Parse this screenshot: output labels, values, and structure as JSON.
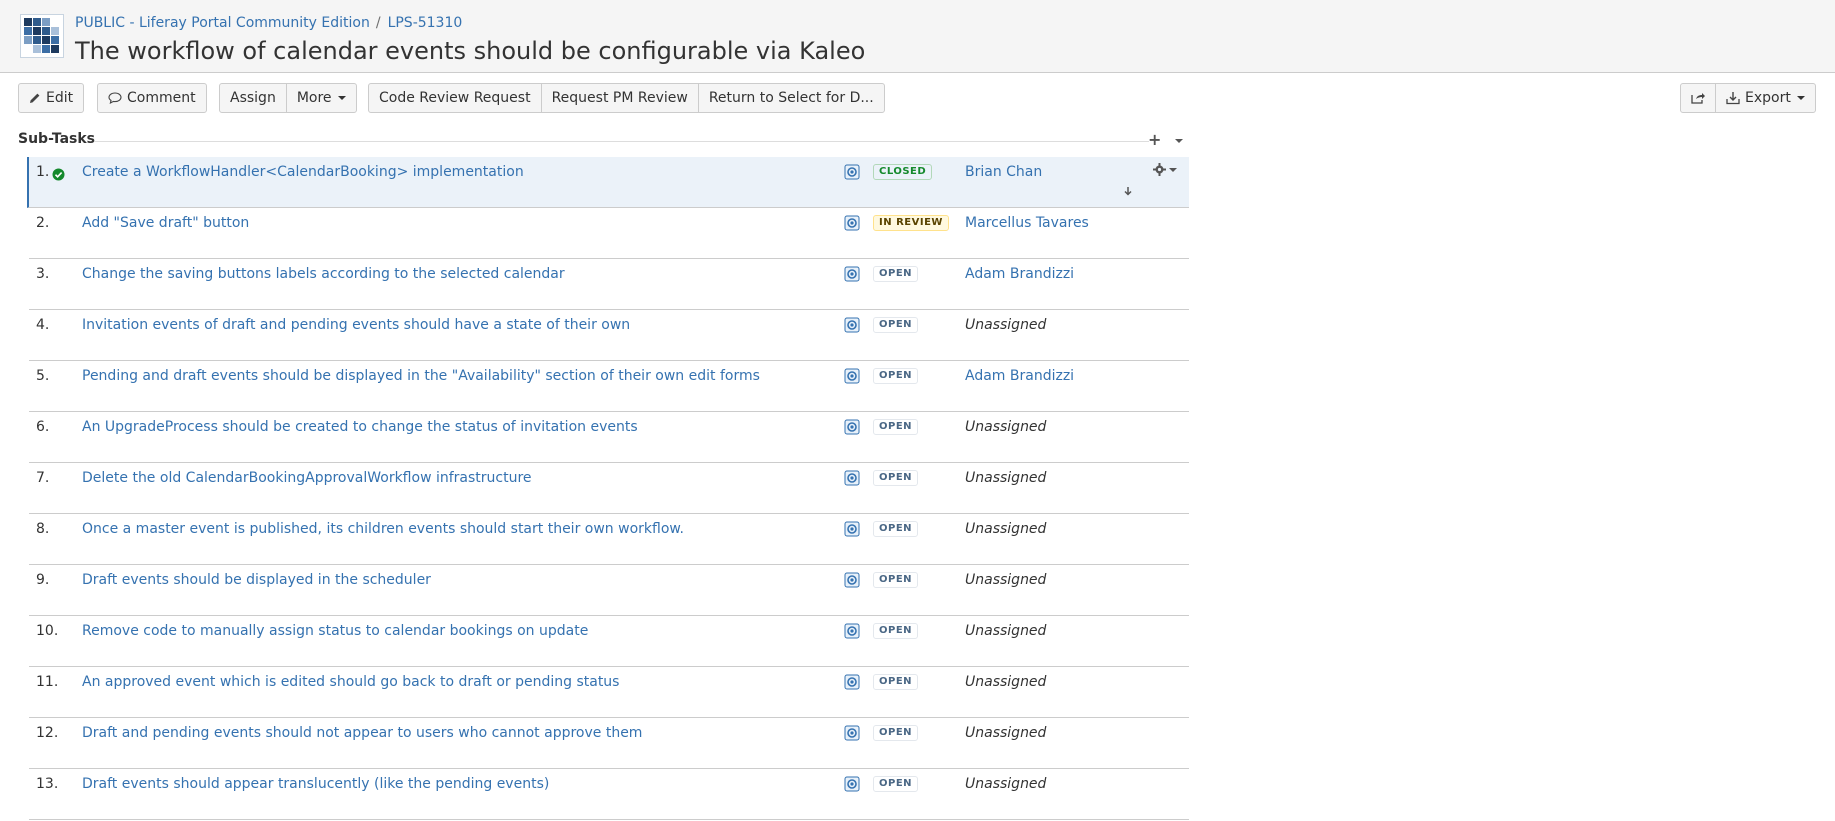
{
  "header": {
    "project": "PUBLIC - Liferay Portal Community Edition",
    "separator": "/",
    "issue_key": "LPS-51310",
    "title": "The workflow of calendar events should be configurable via Kaleo"
  },
  "toolbar": {
    "edit": "Edit",
    "comment": "Comment",
    "assign": "Assign",
    "more": "More",
    "code_review": "Code Review Request",
    "pm_review": "Request PM Review",
    "return_select": "Return to Select for D...",
    "export": "Export"
  },
  "subtasks": {
    "label": "Sub-Tasks",
    "rows": [
      {
        "num": "1.",
        "summary": "Create a WorkflowHandler<CalendarBooking> implementation",
        "status": "CLOSED",
        "assignee": "Brian Chan"
      },
      {
        "num": "2.",
        "summary": "Add \"Save draft\" button",
        "status": "IN REVIEW",
        "assignee": "Marcellus Tavares"
      },
      {
        "num": "3.",
        "summary": "Change the saving buttons labels according to the selected calendar",
        "status": "OPEN",
        "assignee": "Adam Brandizzi"
      },
      {
        "num": "4.",
        "summary": "Invitation events of draft and pending events should have a state of their own",
        "status": "OPEN",
        "assignee": "Unassigned"
      },
      {
        "num": "5.",
        "summary": "Pending and draft events should be displayed in the \"Availability\" section of their own edit forms",
        "status": "OPEN",
        "assignee": "Adam Brandizzi"
      },
      {
        "num": "6.",
        "summary": "An UpgradeProcess should be created to change the status of invitation events",
        "status": "OPEN",
        "assignee": "Unassigned"
      },
      {
        "num": "7.",
        "summary": "Delete the old CalendarBookingApprovalWorkflow infrastructure",
        "status": "OPEN",
        "assignee": "Unassigned"
      },
      {
        "num": "8.",
        "summary": "Once a master event is published, its children events should start their own workflow.",
        "status": "OPEN",
        "assignee": "Unassigned"
      },
      {
        "num": "9.",
        "summary": "Draft events should be displayed in the scheduler",
        "status": "OPEN",
        "assignee": "Unassigned"
      },
      {
        "num": "10.",
        "summary": "Remove code to manually assign status to calendar bookings on update",
        "status": "OPEN",
        "assignee": "Unassigned"
      },
      {
        "num": "11.",
        "summary": "An approved event which is edited should go back to draft or pending status",
        "status": "OPEN",
        "assignee": "Unassigned"
      },
      {
        "num": "12.",
        "summary": "Draft and pending events should not appear to users who cannot approve them",
        "status": "OPEN",
        "assignee": "Unassigned"
      },
      {
        "num": "13.",
        "summary": "Draft events should appear translucently (like the pending events)",
        "status": "OPEN",
        "assignee": "Unassigned"
      }
    ]
  },
  "colors": {
    "link": "#3572b0",
    "closed": "#14892c",
    "review": "#594300",
    "open": "#4a6785",
    "selected_row": "#ebf2f9"
  }
}
